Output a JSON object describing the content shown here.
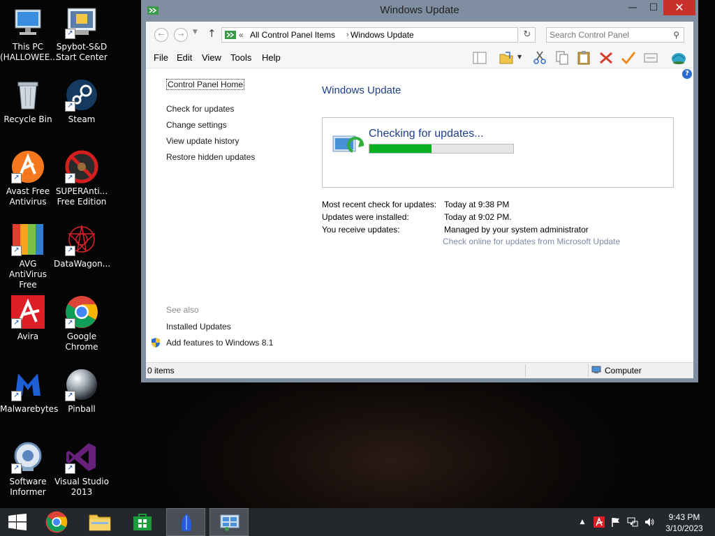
{
  "desktop": {
    "icons": [
      {
        "label": "This PC\n(HALLOWEE..."
      },
      {
        "label": "Spybot-S&D\nStart Center"
      },
      {
        "label": "Recycle Bin"
      },
      {
        "label": "Steam"
      },
      {
        "label": "Avast Free\nAntivirus"
      },
      {
        "label": "SUPERAnti...\nFree Edition"
      },
      {
        "label": "AVG AntiVirus\nFree"
      },
      {
        "label": "DataWagon..."
      },
      {
        "label": "Avira"
      },
      {
        "label": "Google\nChrome"
      },
      {
        "label": "Malwarebytes"
      },
      {
        "label": "Pinball"
      },
      {
        "label": "Software\nInformer"
      },
      {
        "label": "Visual Studio\n2013"
      }
    ]
  },
  "window": {
    "title": "Windows Update",
    "minimize": "—",
    "maximize": "☐",
    "close": "✕",
    "address": {
      "overflow": "«",
      "crumbs": [
        "All Control Panel Items",
        "Windows Update"
      ],
      "separator": "›",
      "search_placeholder": "Search Control Panel"
    },
    "menu": {
      "file": "File",
      "edit": "Edit",
      "view": "View",
      "tools": "Tools",
      "help": "Help"
    },
    "left_pane": {
      "home": "Control Panel Home",
      "links": [
        "Check for updates",
        "Change settings",
        "View update history",
        "Restore hidden updates"
      ],
      "see_also": "See also",
      "see_also_links": [
        "Installed Updates",
        "Add features to Windows 8.1"
      ]
    },
    "main": {
      "title": "Windows Update",
      "status_text": "Checking for updates...",
      "progress": 0.43,
      "info": [
        {
          "label": "Most recent check for updates:",
          "value": "Today at 9:38 PM"
        },
        {
          "label": "Updates were installed:",
          "value": "Today at 9:02 PM."
        },
        {
          "label": "You receive updates:",
          "value": "Managed by your system administrator"
        }
      ],
      "online_link": "Check online for updates from Microsoft Update"
    },
    "statusbar": {
      "items": "0 items",
      "location": "Computer"
    }
  },
  "taskbar": {
    "time": "9:43 PM",
    "date": "3/10/2023"
  },
  "colors": {
    "accent_blue": "#1e3e8a",
    "progress_green": "#06b025",
    "close_red": "#c7302b"
  }
}
